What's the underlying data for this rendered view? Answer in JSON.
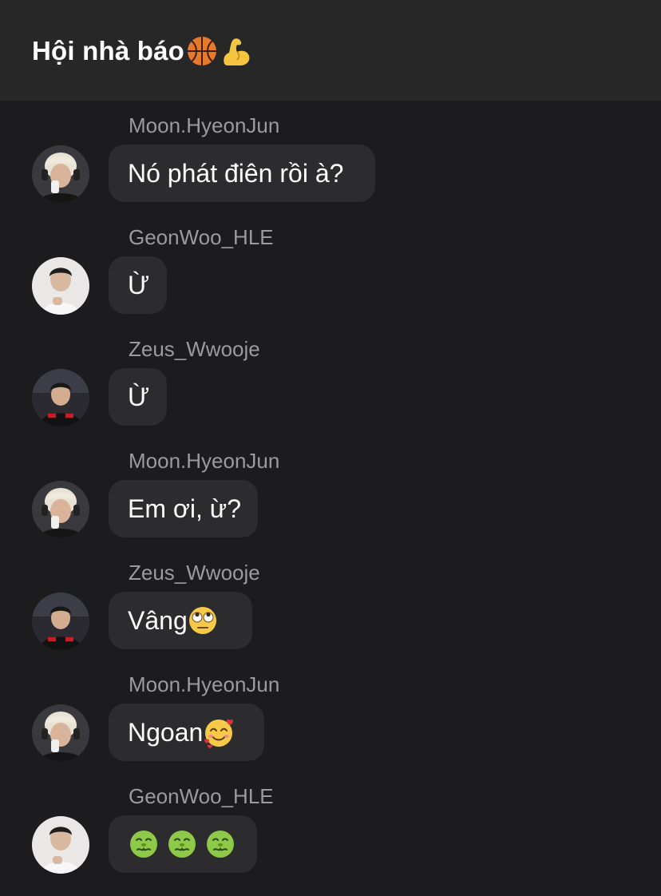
{
  "header": {
    "title": "Hội nhà báo",
    "title_icons": [
      "basketball-icon",
      "flexed-biceps-icon"
    ]
  },
  "messages": [
    {
      "sender": "Moon.HyeonJun",
      "text": "Nó phát điên rồi à?",
      "avatar": "moon-avatar",
      "emojis": []
    },
    {
      "sender": "GeonWoo_HLE",
      "text": "Ừ",
      "avatar": "geonwoo-avatar",
      "emojis": []
    },
    {
      "sender": "Zeus_Wwooje",
      "text": "Ừ",
      "avatar": "zeus-avatar",
      "emojis": []
    },
    {
      "sender": "Moon.HyeonJun",
      "text": "Em ơi, ừ?",
      "avatar": "moon-avatar",
      "emojis": []
    },
    {
      "sender": "Zeus_Wwooje",
      "text": "Vâng",
      "avatar": "zeus-avatar",
      "emojis": [
        "face-with-rolling-eyes-icon"
      ]
    },
    {
      "sender": "Moon.HyeonJun",
      "text": "Ngoan",
      "avatar": "moon-avatar",
      "emojis": [
        "smiling-face-with-hearts-icon"
      ]
    },
    {
      "sender": "GeonWoo_HLE",
      "text": "",
      "avatar": "geonwoo-avatar",
      "emojis": [
        "nauseated-face-icon",
        "nauseated-face-icon",
        "nauseated-face-icon"
      ]
    }
  ],
  "colors": {
    "background": "#1c1c1e",
    "header": "#272728",
    "bubble": "#2c2c2e",
    "sender": "#9a9a9f",
    "text": "#ffffff"
  }
}
